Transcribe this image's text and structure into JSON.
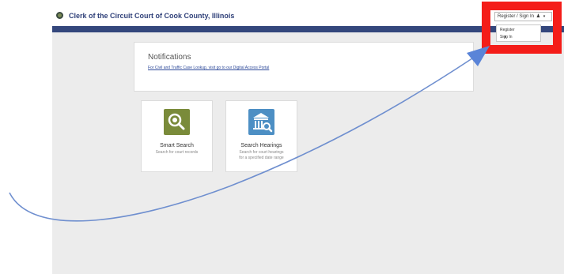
{
  "header": {
    "title": "Clerk of the Circuit Court of Cook County, Illinois",
    "account_button": "Register / Sign In",
    "account_menu": [
      "Register",
      "Sign In"
    ]
  },
  "notifications": {
    "title": "Notifications",
    "link": "For Civil and Traffic Case Lookup, visit go to our Digital Access Portal"
  },
  "tiles": [
    {
      "title": "Smart Search",
      "desc_lines": [
        "Search for court records"
      ],
      "icon": "magnifier-icon"
    },
    {
      "title": "Search Hearings",
      "desc_lines": [
        "Search for court hearings",
        "for a specified date range"
      ],
      "icon": "courthouse-search-icon"
    }
  ],
  "colors": {
    "navbar": "#34477c",
    "highlight": "#f41d19",
    "arrow": "#6f8fcf",
    "smart_search_icon_bg": "#7a8b3a",
    "hearings_icon_bg": "#4d8fc4"
  }
}
